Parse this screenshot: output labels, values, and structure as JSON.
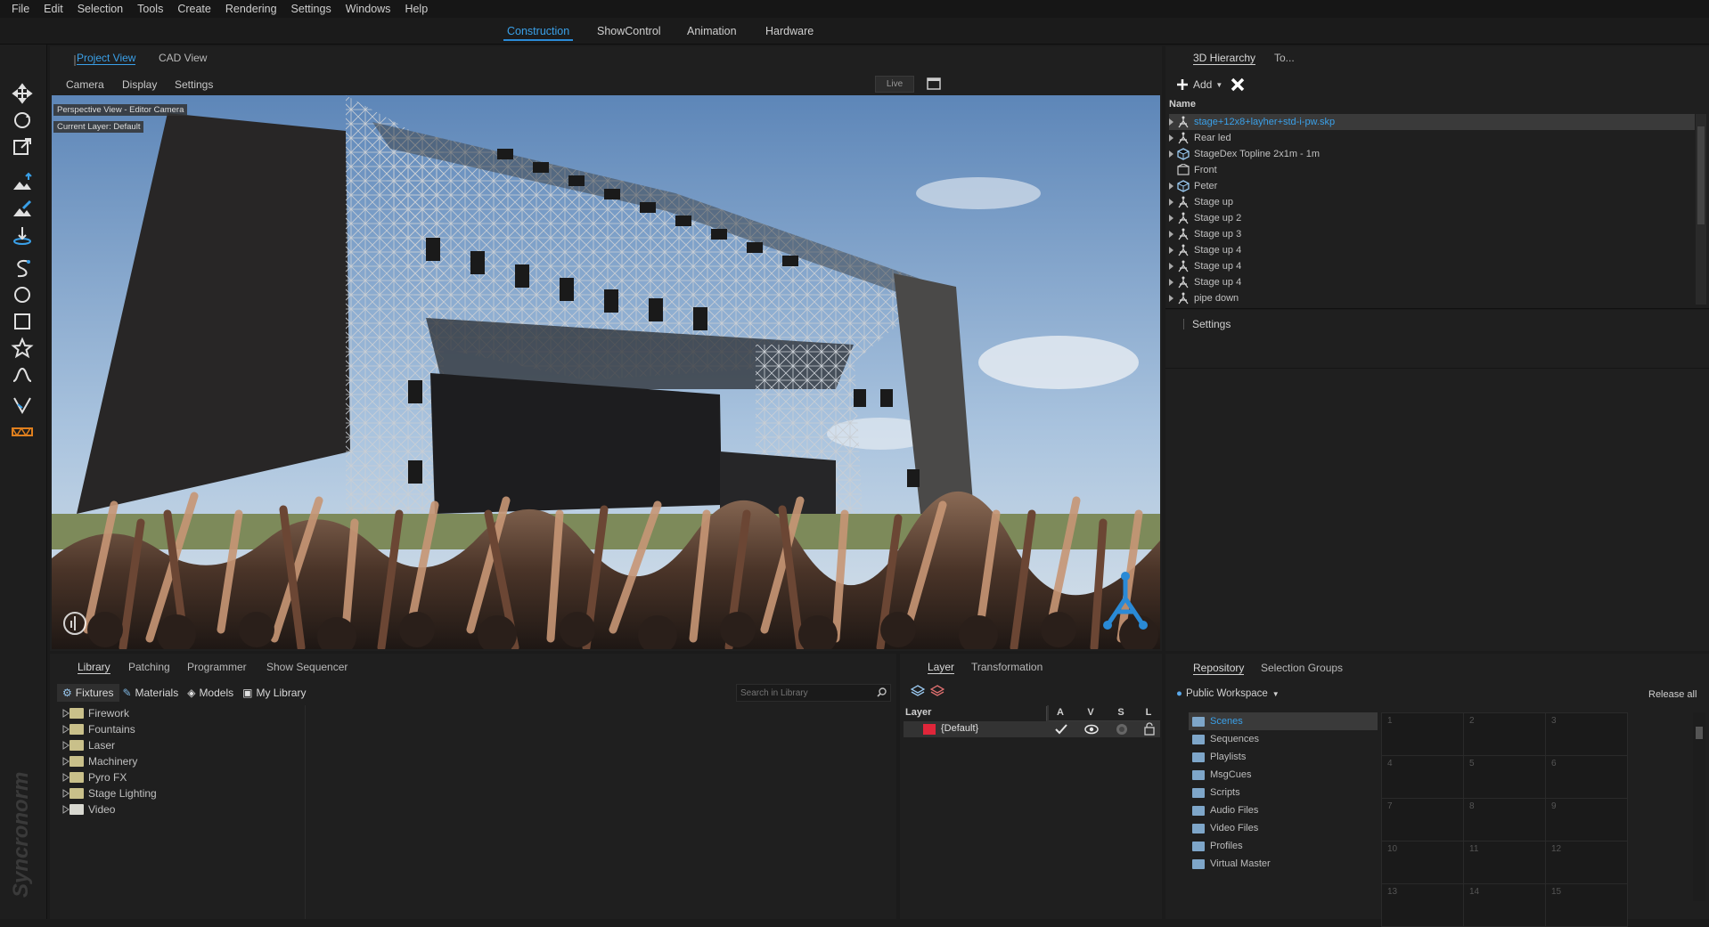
{
  "menu": [
    "File",
    "Edit",
    "Selection",
    "Tools",
    "Create",
    "Rendering",
    "Settings",
    "Windows",
    "Help"
  ],
  "modes": [
    {
      "label": "Construction",
      "active": true
    },
    {
      "label": "ShowControl",
      "active": false
    },
    {
      "label": "Animation",
      "active": false
    },
    {
      "label": "Hardware",
      "active": false
    }
  ],
  "viewport": {
    "tabs": [
      "Project View",
      "CAD View"
    ],
    "subtabs": [
      "Camera",
      "Display",
      "Settings"
    ],
    "live_label": "Live",
    "overlay_view": "Perspective View - Editor Camera",
    "overlay_layer": "Current Layer: Default"
  },
  "hierarchy": {
    "tabs": [
      "3D Hierarchy",
      "To..."
    ],
    "add_label": "Add",
    "column_name": "Name",
    "items": [
      {
        "label": "stage+12x8+layher+std-i-pw.skp",
        "selected": true,
        "icon": "group-icon",
        "expandable": true
      },
      {
        "label": "Rear led",
        "selected": false,
        "icon": "group-icon",
        "expandable": true
      },
      {
        "label": "StageDex Topline 2x1m - 1m",
        "selected": false,
        "icon": "cube-icon",
        "expandable": true
      },
      {
        "label": "Front",
        "selected": false,
        "icon": "truss-icon",
        "expandable": false
      },
      {
        "label": "Peter",
        "selected": false,
        "icon": "cube-icon",
        "expandable": true
      },
      {
        "label": "Stage up",
        "selected": false,
        "icon": "group-icon",
        "expandable": true
      },
      {
        "label": "Stage up 2",
        "selected": false,
        "icon": "group-icon",
        "expandable": true
      },
      {
        "label": "Stage up 3",
        "selected": false,
        "icon": "group-icon",
        "expandable": true
      },
      {
        "label": "Stage up 4",
        "selected": false,
        "icon": "group-icon",
        "expandable": true
      },
      {
        "label": "Stage up 4",
        "selected": false,
        "icon": "group-icon",
        "expandable": true
      },
      {
        "label": "Stage up 4",
        "selected": false,
        "icon": "group-icon",
        "expandable": true
      },
      {
        "label": "pipe down",
        "selected": false,
        "icon": "group-icon",
        "expandable": true
      }
    ],
    "settings_label": "Settings"
  },
  "library": {
    "tabs": [
      "Library",
      "Patching",
      "Programmer",
      "Show Sequencer"
    ],
    "filters": [
      "Fixtures",
      "Materials",
      "Models",
      "My Library"
    ],
    "search_placeholder": "Search in Library",
    "folders": [
      "Firework",
      "Fountains",
      "Laser",
      "Machinery",
      "Pyro FX",
      "Stage Lighting",
      "Video"
    ]
  },
  "layer": {
    "tabs": [
      "Layer",
      "Transformation"
    ],
    "columns": [
      "Layer",
      "A",
      "V",
      "S",
      "L"
    ],
    "rows": [
      {
        "name": "{Default}",
        "color": "#e0263a"
      }
    ]
  },
  "repository": {
    "tabs": [
      "Repository",
      "Selection Groups"
    ],
    "workspace": "Public Workspace",
    "release_all": "Release all",
    "items": [
      "Scenes",
      "Sequences",
      "Playlists",
      "MsgCues",
      "Scripts",
      "Audio Files",
      "Video Files",
      "Profiles",
      "Virtual Master"
    ],
    "selected": "Scenes",
    "grid": [
      "1",
      "2",
      "3",
      "4",
      "5",
      "6",
      "7",
      "8",
      "9",
      "10",
      "11",
      "12",
      "13",
      "14",
      "15"
    ]
  },
  "brand": "Syncronorm",
  "colors": {
    "accent": "#3aa0e8",
    "bg": "#1b1b1b",
    "panel": "#1f1f1f"
  }
}
